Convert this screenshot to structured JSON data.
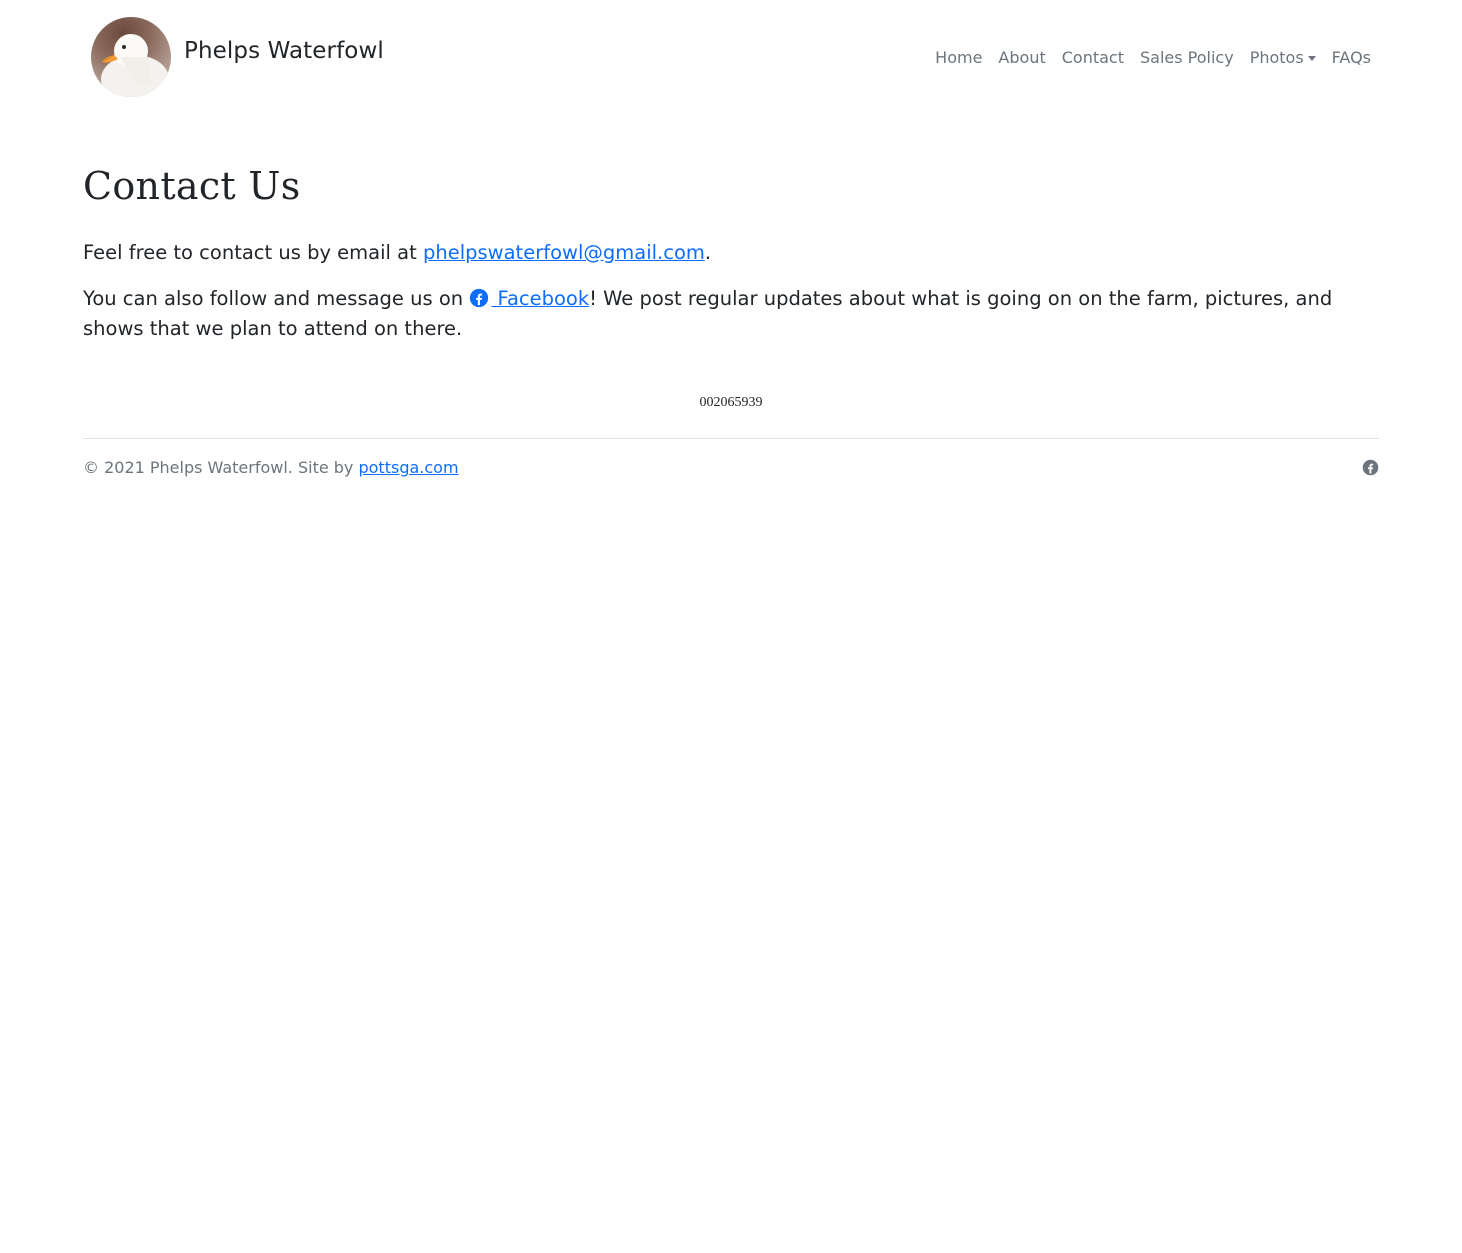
{
  "header": {
    "brand_name": "Phelps Waterfowl",
    "logo_alt": "duck-photo",
    "nav": [
      {
        "label": "Home"
      },
      {
        "label": "About"
      },
      {
        "label": "Contact"
      },
      {
        "label": "Sales Policy"
      },
      {
        "label": "Photos",
        "dropdown": true
      },
      {
        "label": "FAQs"
      }
    ]
  },
  "main": {
    "title": "Contact Us",
    "para1_prefix": "Feel free to contact us by email at ",
    "email": "phelpswaterfowl@gmail.com",
    "para1_suffix": ".",
    "para2_prefix": "You can also follow and message us on ",
    "facebook_label": " Facebook",
    "para2_suffix": "! We post regular updates about what is going on on the farm, pictures, and shows that we plan to attend on there.",
    "counter": "002065939"
  },
  "footer": {
    "copyright": "© 2021 Phelps Waterfowl. Site by ",
    "site_link": "pottsga.com",
    "social_icon": "facebook-icon"
  },
  "colors": {
    "link": "#0d6efd",
    "muted": "#6c757d",
    "text": "#212529",
    "divider": "#dee2e6"
  }
}
